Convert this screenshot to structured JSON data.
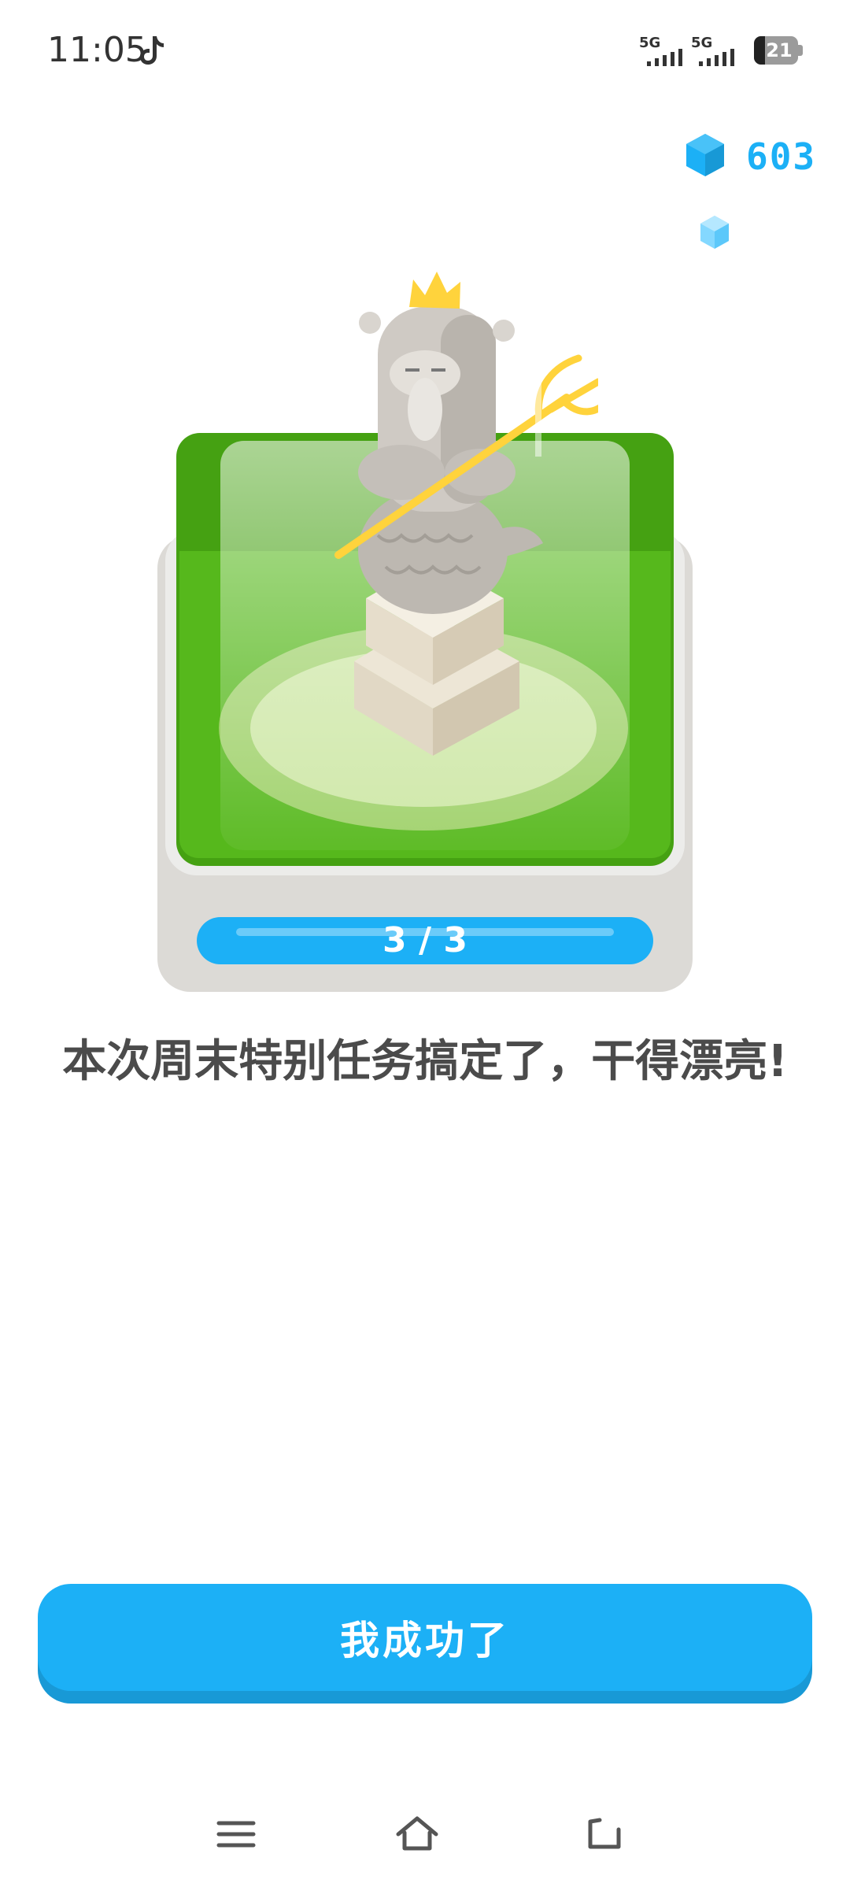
{
  "status_bar": {
    "time": "11:05",
    "signal_1_label": "5G",
    "signal_2_label": "5G",
    "battery_level": "21"
  },
  "gems": {
    "count": "603",
    "color": "#1cb0f6"
  },
  "progress": {
    "text": "3 / 3"
  },
  "message": {
    "text": "本次周末特别任务搞定了，干得漂亮!"
  },
  "cta": {
    "label": "我成功了",
    "color": "#1cb0f6"
  },
  "icons": {
    "tiktok": "tiktok-icon",
    "gem": "gem-icon",
    "menu": "menu-icon",
    "home": "home-icon",
    "back": "back-icon"
  }
}
